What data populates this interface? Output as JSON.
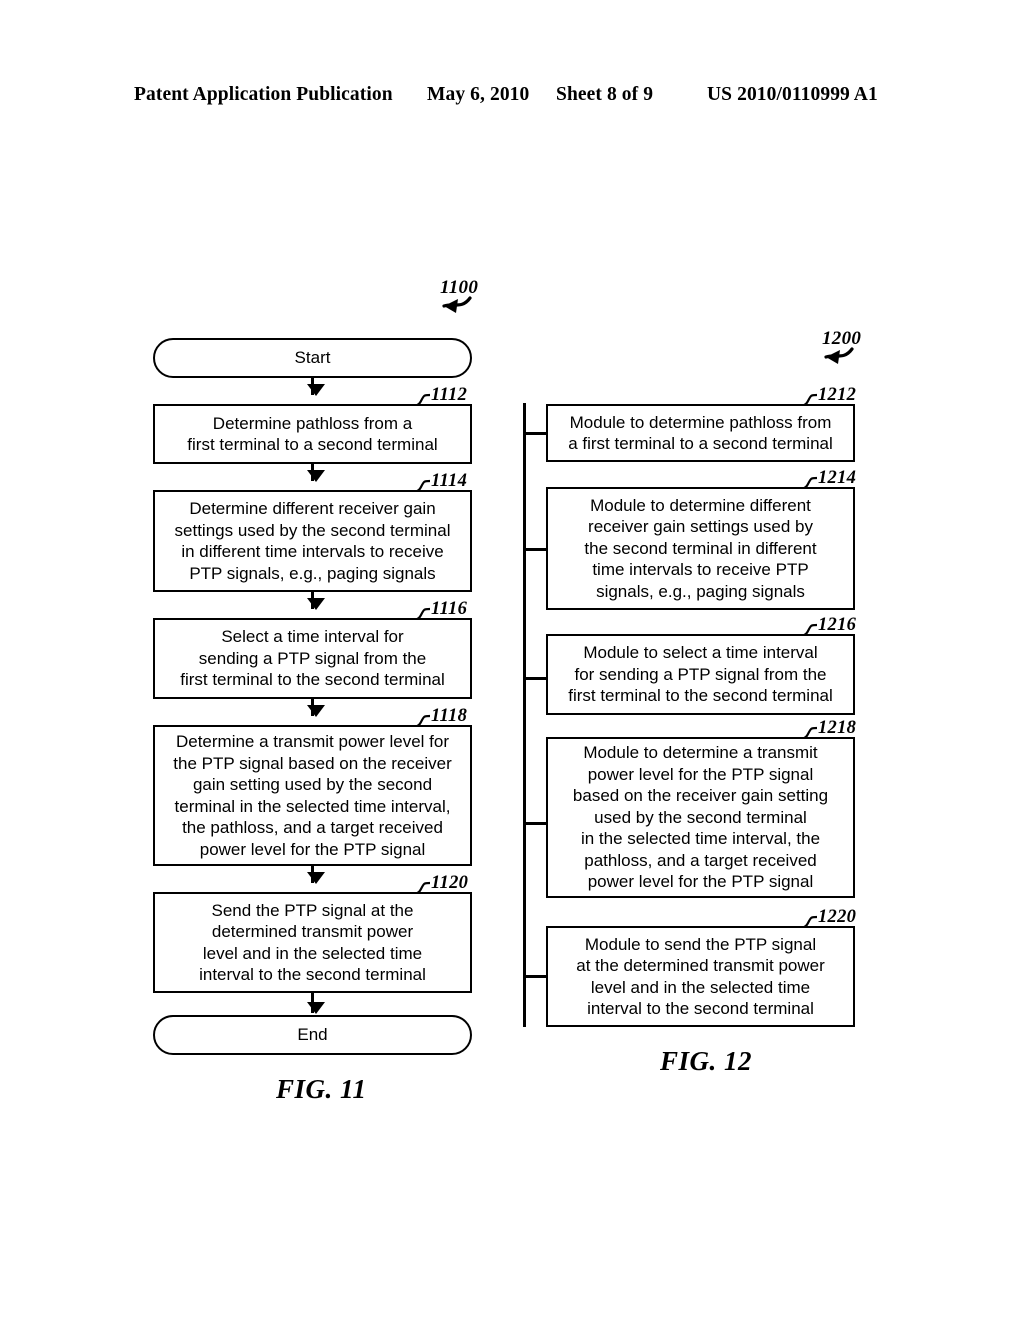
{
  "header": {
    "publication": "Patent Application Publication",
    "date": "May 6, 2010",
    "sheet": "Sheet 8 of 9",
    "patent_number": "US 2010/0110999 A1"
  },
  "figure_11": {
    "caption": "FIG. 11",
    "callout_label": "1100",
    "start_label": "Start",
    "end_label": "End",
    "steps": [
      {
        "ref": "1112",
        "text": "Determine pathloss from a\nfirst terminal to a second terminal"
      },
      {
        "ref": "1114",
        "text": "Determine different receiver gain\nsettings used by the second terminal\nin different time intervals to receive\nPTP signals, e.g., paging signals"
      },
      {
        "ref": "1116",
        "text": "Select a time interval for\nsending a PTP signal from the\nfirst terminal to the second terminal"
      },
      {
        "ref": "1118",
        "text": "Determine a transmit power level for\nthe PTP signal based on the receiver\ngain setting used by the second\nterminal in the selected time interval,\nthe pathloss, and a target received\npower level  for the PTP signal"
      },
      {
        "ref": "1120",
        "text": "Send the PTP signal at the\ndetermined transmit power\nlevel and in the selected time\ninterval to the second terminal"
      }
    ]
  },
  "figure_12": {
    "caption": "FIG. 12",
    "callout_label": "1200",
    "modules": [
      {
        "ref": "1212",
        "text": "Module to determine pathloss from\na first terminal to a second terminal"
      },
      {
        "ref": "1214",
        "text": "Module to determine different\nreceiver gain settings used by\nthe second terminal in different\ntime intervals to receive PTP\nsignals, e.g., paging signals"
      },
      {
        "ref": "1216",
        "text": "Module to select a time interval\nfor sending a PTP signal from the\nfirst terminal to the second terminal"
      },
      {
        "ref": "1218",
        "text": "Module to determine a transmit\npower level for the PTP signal\nbased on the receiver gain setting\nused by the second terminal\nin the selected time interval, the\npathloss, and a target received\npower level for the PTP signal"
      },
      {
        "ref": "1220",
        "text": "Module to send the PTP signal\nat the determined transmit power\nlevel and in the selected time\ninterval to the second terminal"
      }
    ]
  }
}
